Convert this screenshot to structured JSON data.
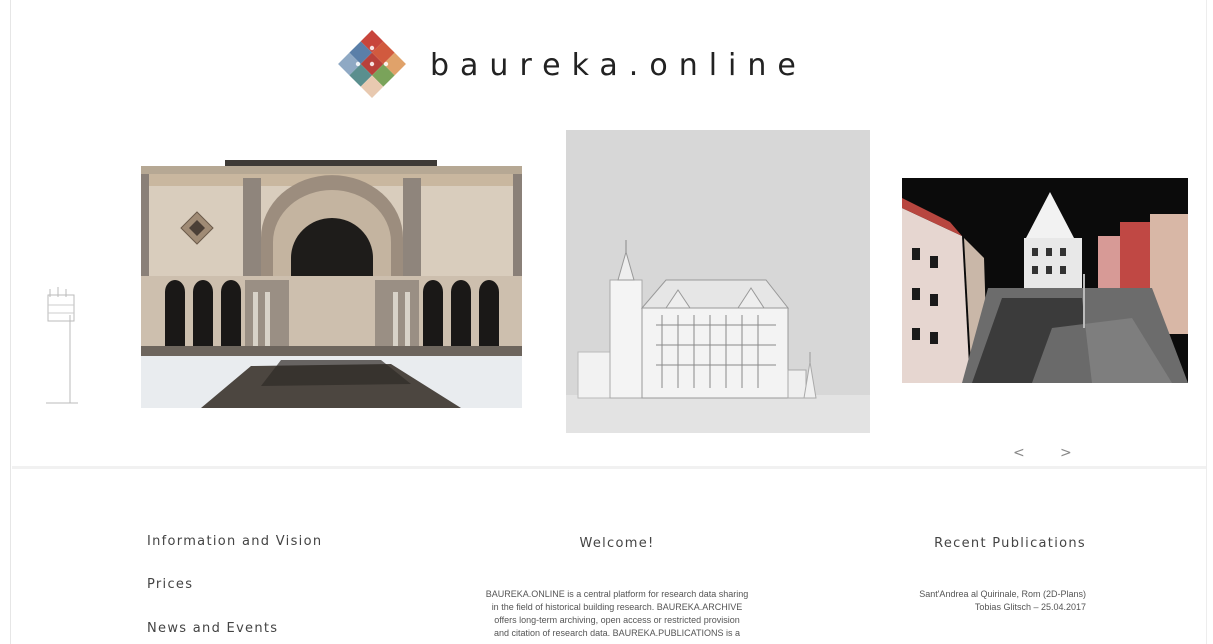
{
  "brand": {
    "name": "baureka.online"
  },
  "carousel": {
    "slides": [
      {
        "icon": "tower-drawing-icon",
        "kind": "partial-thumbnail"
      },
      {
        "icon": "romanesque-arcade-photo",
        "kind": "photo"
      },
      {
        "icon": "town-hall-3d-model",
        "kind": "render"
      },
      {
        "icon": "town-square-pointcloud",
        "kind": "scan"
      }
    ],
    "prev_label": "<",
    "next_label": ">"
  },
  "nav": {
    "items": [
      {
        "label": "Information and Vision"
      },
      {
        "label": "Prices"
      },
      {
        "label": "News and Events"
      }
    ]
  },
  "welcome": {
    "title": "Welcome!",
    "line1": "BAUREKA.ONLINE is a central platform for research data sharing",
    "line2": "in the field of historical building research. BAUREKA.ARCHIVE",
    "line3": "offers long-term archiving, open access or restricted provision",
    "line4": "and citation of research data. BAUREKA.PUBLICATIONS is a"
  },
  "publications": {
    "title": "Recent Publications",
    "items": [
      {
        "title": "Sant'Andrea al Quirinale, Rom (2D-Plans)",
        "meta": "Tobias Glitsch – 25.04.2017"
      }
    ]
  },
  "colors": {
    "background": "#ffffff",
    "text": "#444444",
    "logo_red": "#c8453c",
    "logo_teal": "#5a8f8e",
    "logo_green": "#7aa35a",
    "logo_blue": "#5a7fa8"
  }
}
